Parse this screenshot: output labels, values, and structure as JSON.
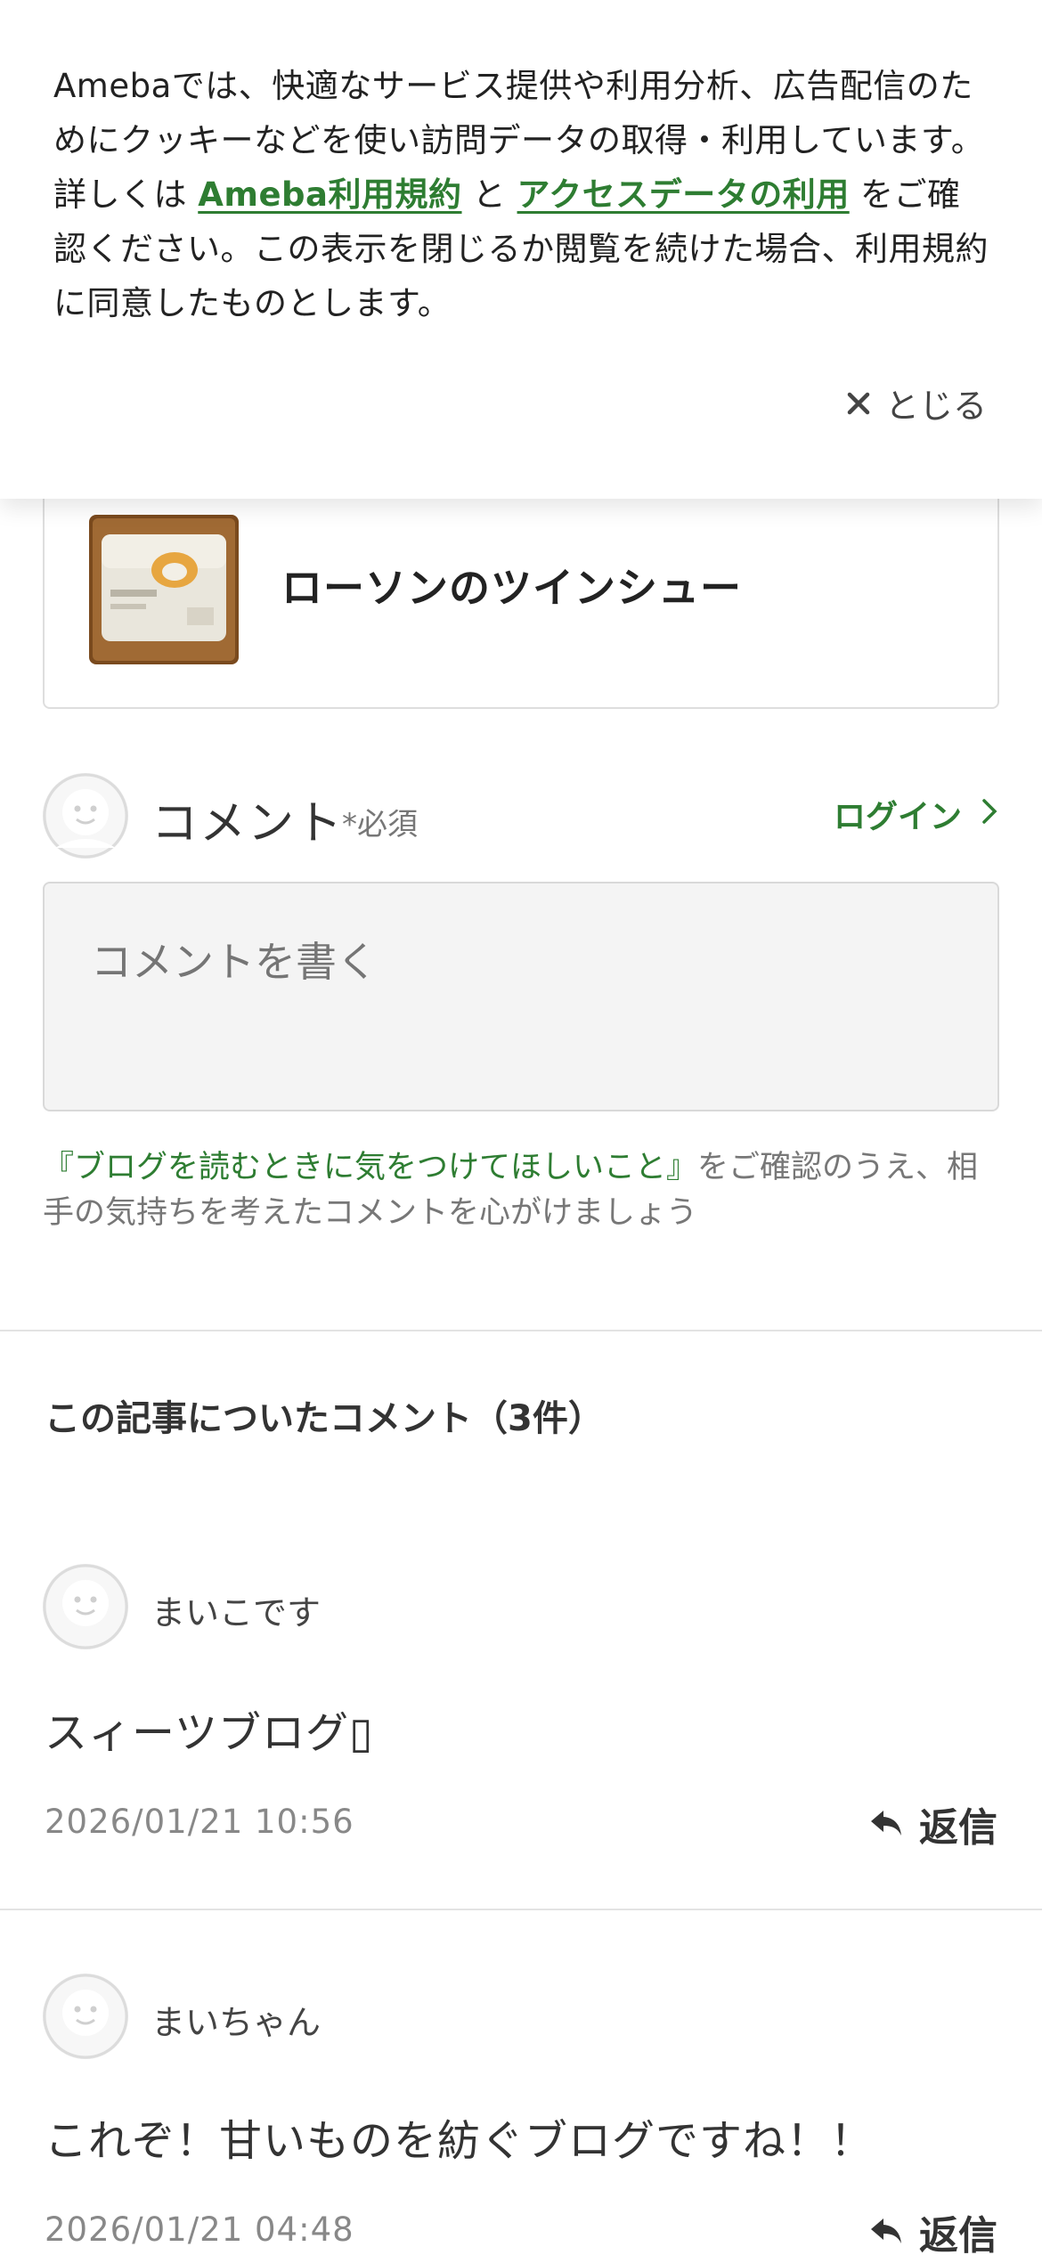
{
  "cookie_banner": {
    "text_part1": "Amebaでは、快適なサービス提供や利用分析、広告配信のためにクッキーなどを使い訪問データの取得・利用しています。詳しくは",
    "link_terms": "Ameba利用規約",
    "connector": "と",
    "link_access_data": "アクセスデータの利用",
    "text_part2": "をご確認ください。この表示を閉じるか閲覧を続けた場合、利用規約に同意したものとします。",
    "close_label": "とじる",
    "close_icon": "close-icon"
  },
  "article": {
    "title": "ローソンのツインシュー"
  },
  "comment_form": {
    "heading": "コメント",
    "required_label": "*必須",
    "login_label": "ログイン",
    "placeholder": "コメントを書く",
    "guide_link": "『ブログを読むときに気をつけてほしいこと』",
    "guide_text": "をご確認のうえ、相手の気持ちを考えたコメントを心がけましょう"
  },
  "comments_section": {
    "title": "この記事についたコメント（3件）",
    "reply_label": "返信",
    "reply_icon": "reply-icon",
    "items": [
      {
        "name": "まいこです",
        "body": "スィーツブログ▯",
        "date": "2026/01/21 10:56"
      },
      {
        "name": "まいちゃん",
        "body": "これぞ！甘いものを紡ぐブログですね！！",
        "date": "2026/01/21 04:48"
      }
    ]
  },
  "colors": {
    "accent_green": "#2e7d32",
    "text_dark": "#333333",
    "text_muted": "#888888"
  }
}
